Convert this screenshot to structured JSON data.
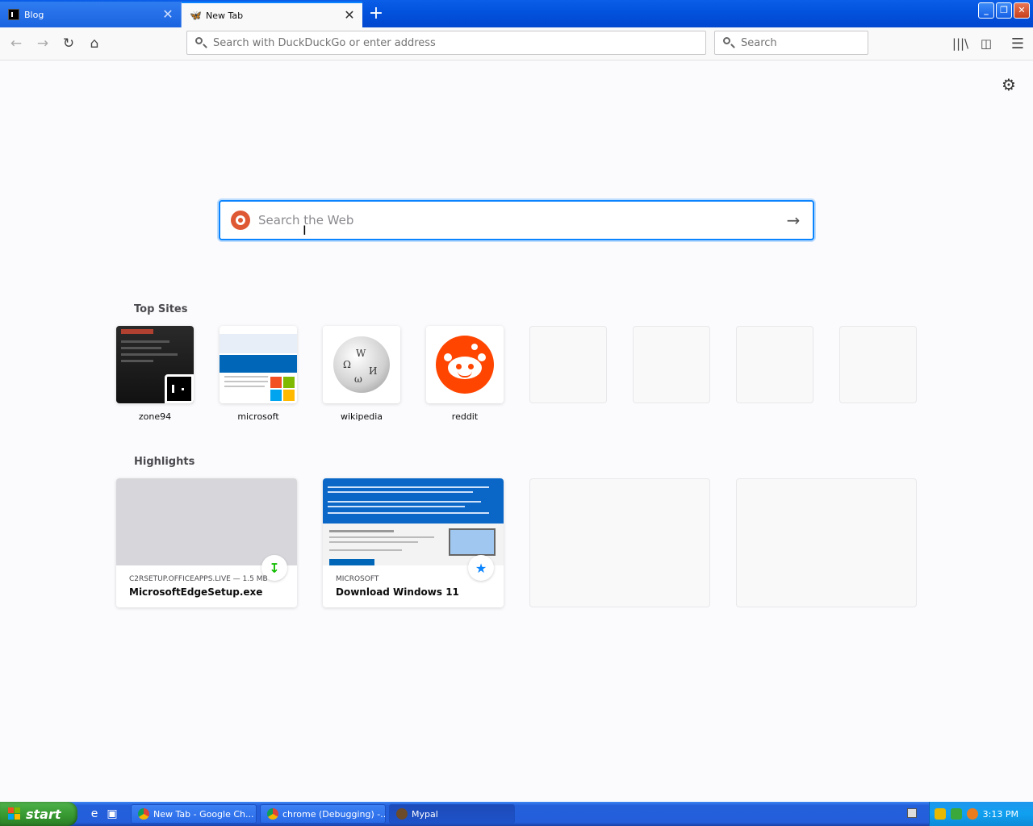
{
  "tabs": [
    {
      "title": "Blog",
      "active": false
    },
    {
      "title": "New Tab",
      "active": true
    }
  ],
  "toolbar": {
    "url_placeholder": "Search with DuckDuckGo or enter address",
    "search_placeholder": "Search"
  },
  "newtab": {
    "web_search_placeholder": "Search the Web",
    "top_sites_title": "Top Sites",
    "top_sites": [
      {
        "label": "zone94"
      },
      {
        "label": "microsoft"
      },
      {
        "label": "wikipedia"
      },
      {
        "label": "reddit"
      }
    ],
    "highlights_title": "Highlights",
    "highlights": [
      {
        "source": "C2RSETUP.OFFICEAPPS.LIVE — 1.5 MB",
        "title": "MicrosoftEdgeSetup.exe",
        "type": "download"
      },
      {
        "source": "MICROSOFT",
        "title": "Download Windows 11",
        "type": "bookmark"
      }
    ]
  },
  "taskbar": {
    "start_label": "start",
    "tasks": [
      {
        "label": "New Tab - Google Ch..."
      },
      {
        "label": "chrome (Debugging) -..."
      },
      {
        "label": "Mypal"
      }
    ],
    "clock": "3:13 PM"
  },
  "colors": {
    "accent": "#0a84ff",
    "reddit": "#ff4500",
    "duckduckgo": "#de5833",
    "xp_blue": "#245edb",
    "xp_start_green": "#35962f"
  }
}
